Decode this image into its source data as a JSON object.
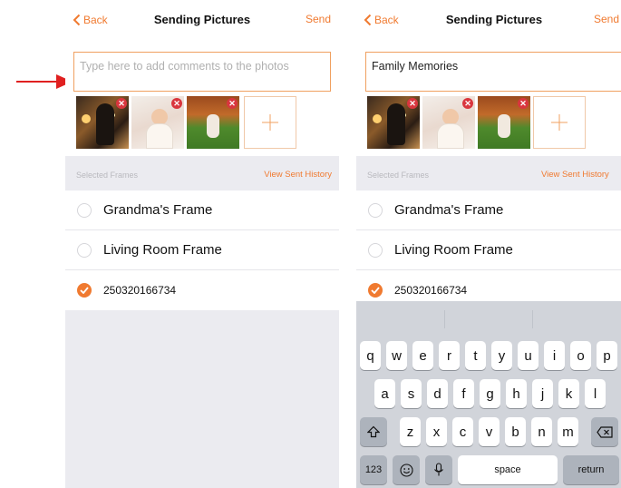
{
  "screens": [
    {
      "nav": {
        "back_label": "Back",
        "title": "Sending Pictures",
        "send_label": "Send"
      },
      "comment": {
        "placeholder": "Type here to add comments to the photos",
        "value": ""
      },
      "section": {
        "label": "Selected Frames",
        "history_label": "View Sent History"
      },
      "frames": [
        {
          "name": "Grandma's Frame",
          "selected": false
        },
        {
          "name": "Living Room Frame",
          "selected": false
        },
        {
          "name": "250320166734",
          "selected": true
        }
      ]
    },
    {
      "nav": {
        "back_label": "Back",
        "title": "Sending Pictures",
        "send_label": "Send"
      },
      "comment": {
        "placeholder": "",
        "value": "Family Memories"
      },
      "section": {
        "label": "Selected Frames",
        "history_label": "View Sent History"
      },
      "frames": [
        {
          "name": "Grandma's Frame",
          "selected": false
        },
        {
          "name": "Living Room Frame",
          "selected": false
        },
        {
          "name": "250320166734",
          "selected": true
        }
      ],
      "keyboard": {
        "row1": [
          "q",
          "w",
          "e",
          "r",
          "t",
          "y",
          "u",
          "i",
          "o",
          "p"
        ],
        "row2": [
          "a",
          "s",
          "d",
          "f",
          "g",
          "h",
          "j",
          "k",
          "l"
        ],
        "row3": [
          "z",
          "x",
          "c",
          "v",
          "b",
          "n",
          "m"
        ],
        "numbers_label": "123",
        "space_label": "space",
        "return_label": "return"
      }
    }
  ],
  "colors": {
    "accent": "#f07a30",
    "arrow": "#e02020",
    "delete_badge": "#d9363e"
  }
}
